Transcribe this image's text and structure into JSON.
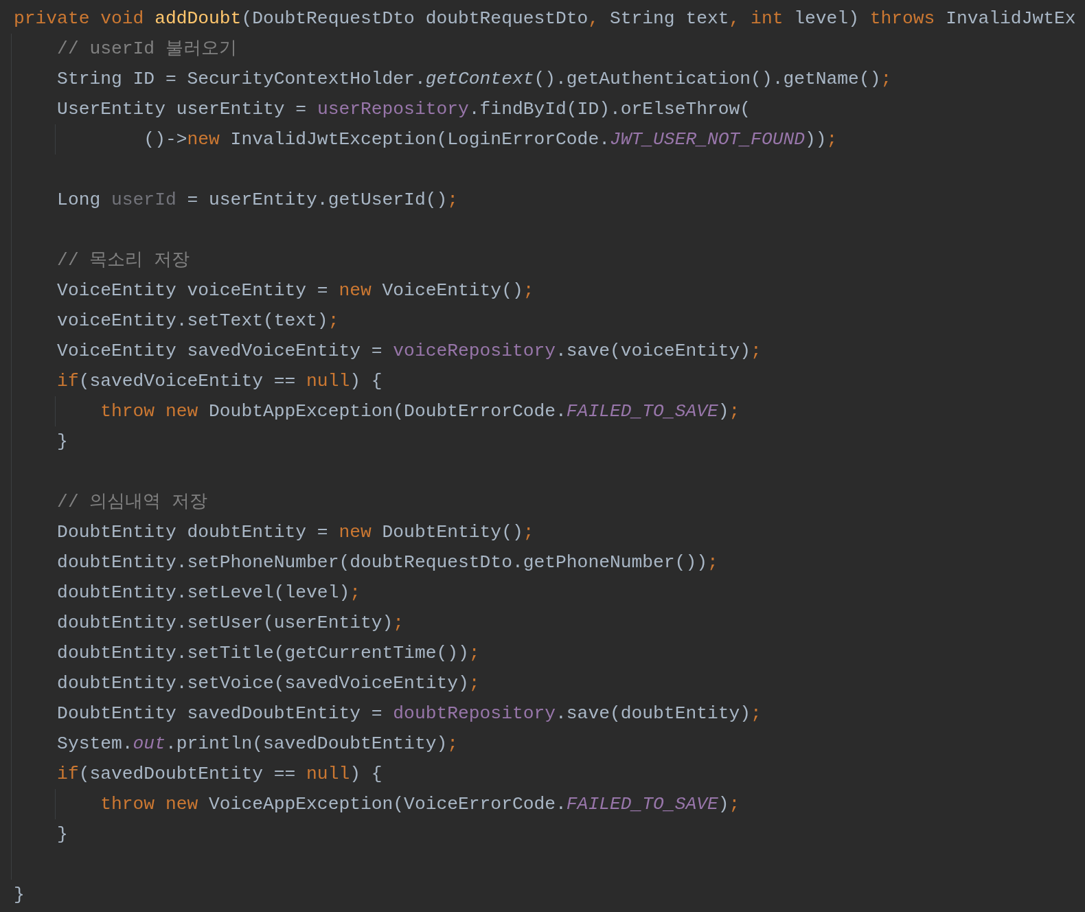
{
  "editor": {
    "lines": [
      {
        "kind": "code",
        "tokens": [
          {
            "kind": "keyword",
            "text": "private void "
          },
          {
            "kind": "method",
            "text": "addDoubt"
          },
          {
            "kind": "plain",
            "text": "(DoubtRequestDto doubtRequestDto"
          },
          {
            "kind": "keyword",
            "text": ", "
          },
          {
            "kind": "plain",
            "text": "String text"
          },
          {
            "kind": "keyword",
            "text": ", int "
          },
          {
            "kind": "plain",
            "text": "level) "
          },
          {
            "kind": "keyword",
            "text": "throws "
          },
          {
            "kind": "plain",
            "text": "InvalidJwtEx"
          }
        ]
      },
      {
        "kind": "code",
        "tokens": [
          {
            "kind": "comment",
            "text": "    // userId 불러오기"
          }
        ]
      },
      {
        "kind": "code",
        "tokens": [
          {
            "kind": "plain",
            "text": "    String ID = SecurityContextHolder."
          },
          {
            "kind": "static_call",
            "text": "getContext"
          },
          {
            "kind": "plain",
            "text": "().getAuthentication().getName()"
          },
          {
            "kind": "keyword",
            "text": ";"
          }
        ]
      },
      {
        "kind": "code",
        "tokens": [
          {
            "kind": "plain",
            "text": "    UserEntity userEntity = "
          },
          {
            "kind": "field",
            "text": "userRepository"
          },
          {
            "kind": "plain",
            "text": ".findById(ID).orElseThrow("
          }
        ]
      },
      {
        "kind": "code",
        "tokens": [
          {
            "kind": "plain",
            "text": "            ()->"
          },
          {
            "kind": "keyword",
            "text": "new"
          },
          {
            "kind": "plain",
            "text": " InvalidJwtException(LoginErrorCode."
          },
          {
            "kind": "static_field",
            "text": "JWT_USER_NOT_FOUND"
          },
          {
            "kind": "plain",
            "text": "))"
          },
          {
            "kind": "keyword",
            "text": ";"
          }
        ]
      },
      {
        "kind": "blank"
      },
      {
        "kind": "code",
        "tokens": [
          {
            "kind": "plain",
            "text": "    Long "
          },
          {
            "kind": "unused",
            "text": "userId"
          },
          {
            "kind": "plain",
            "text": " = userEntity.getUserId()"
          },
          {
            "kind": "keyword",
            "text": ";"
          }
        ]
      },
      {
        "kind": "blank"
      },
      {
        "kind": "code",
        "tokens": [
          {
            "kind": "comment",
            "text": "    // 목소리 저장"
          }
        ]
      },
      {
        "kind": "code",
        "tokens": [
          {
            "kind": "plain",
            "text": "    VoiceEntity voiceEntity = "
          },
          {
            "kind": "keyword",
            "text": "new "
          },
          {
            "kind": "plain",
            "text": "VoiceEntity()"
          },
          {
            "kind": "keyword",
            "text": ";"
          }
        ]
      },
      {
        "kind": "code",
        "tokens": [
          {
            "kind": "plain",
            "text": "    voiceEntity.setText(text)"
          },
          {
            "kind": "keyword",
            "text": ";"
          }
        ]
      },
      {
        "kind": "code",
        "tokens": [
          {
            "kind": "plain",
            "text": "    VoiceEntity savedVoiceEntity = "
          },
          {
            "kind": "field",
            "text": "voiceRepository"
          },
          {
            "kind": "plain",
            "text": ".save(voiceEntity)"
          },
          {
            "kind": "keyword",
            "text": ";"
          }
        ]
      },
      {
        "kind": "code",
        "tokens": [
          {
            "kind": "keyword",
            "text": "    if"
          },
          {
            "kind": "plain",
            "text": "(savedVoiceEntity == "
          },
          {
            "kind": "keyword",
            "text": "null"
          },
          {
            "kind": "plain",
            "text": ") {"
          }
        ]
      },
      {
        "kind": "code",
        "tokens": [
          {
            "kind": "keyword",
            "text": "        throw new "
          },
          {
            "kind": "plain",
            "text": "DoubtAppException(DoubtErrorCode."
          },
          {
            "kind": "static_field",
            "text": "FAILED_TO_SAVE"
          },
          {
            "kind": "plain",
            "text": ")"
          },
          {
            "kind": "keyword",
            "text": ";"
          }
        ]
      },
      {
        "kind": "code",
        "tokens": [
          {
            "kind": "plain",
            "text": "    }"
          }
        ]
      },
      {
        "kind": "blank"
      },
      {
        "kind": "code",
        "tokens": [
          {
            "kind": "comment",
            "text": "    // 의심내역 저장"
          }
        ]
      },
      {
        "kind": "code",
        "tokens": [
          {
            "kind": "plain",
            "text": "    DoubtEntity doubtEntity = "
          },
          {
            "kind": "keyword",
            "text": "new "
          },
          {
            "kind": "plain",
            "text": "DoubtEntity()"
          },
          {
            "kind": "keyword",
            "text": ";"
          }
        ]
      },
      {
        "kind": "code",
        "tokens": [
          {
            "kind": "plain",
            "text": "    doubtEntity.setPhoneNumber(doubtRequestDto.getPhoneNumber())"
          },
          {
            "kind": "keyword",
            "text": ";"
          }
        ]
      },
      {
        "kind": "code",
        "tokens": [
          {
            "kind": "plain",
            "text": "    doubtEntity.setLevel(level)"
          },
          {
            "kind": "keyword",
            "text": ";"
          }
        ]
      },
      {
        "kind": "code",
        "tokens": [
          {
            "kind": "plain",
            "text": "    doubtEntity.setUser(userEntity)"
          },
          {
            "kind": "keyword",
            "text": ";"
          }
        ]
      },
      {
        "kind": "code",
        "tokens": [
          {
            "kind": "plain",
            "text": "    doubtEntity.setTitle(getCurrentTime())"
          },
          {
            "kind": "keyword",
            "text": ";"
          }
        ]
      },
      {
        "kind": "code",
        "tokens": [
          {
            "kind": "plain",
            "text": "    doubtEntity.setVoice(savedVoiceEntity)"
          },
          {
            "kind": "keyword",
            "text": ";"
          }
        ]
      },
      {
        "kind": "code",
        "tokens": [
          {
            "kind": "plain",
            "text": "    DoubtEntity savedDoubtEntity = "
          },
          {
            "kind": "field",
            "text": "doubtRepository"
          },
          {
            "kind": "plain",
            "text": ".save(doubtEntity)"
          },
          {
            "kind": "keyword",
            "text": ";"
          }
        ]
      },
      {
        "kind": "code",
        "tokens": [
          {
            "kind": "plain",
            "text": "    System."
          },
          {
            "kind": "static_field",
            "text": "out"
          },
          {
            "kind": "plain",
            "text": ".println(savedDoubtEntity)"
          },
          {
            "kind": "keyword",
            "text": ";"
          }
        ]
      },
      {
        "kind": "code",
        "tokens": [
          {
            "kind": "keyword",
            "text": "    if"
          },
          {
            "kind": "plain",
            "text": "(savedDoubtEntity == "
          },
          {
            "kind": "keyword",
            "text": "null"
          },
          {
            "kind": "plain",
            "text": ") {"
          }
        ]
      },
      {
        "kind": "code",
        "tokens": [
          {
            "kind": "keyword",
            "text": "        throw new "
          },
          {
            "kind": "plain",
            "text": "VoiceAppException(VoiceErrorCode."
          },
          {
            "kind": "static_field",
            "text": "FAILED_TO_SAVE"
          },
          {
            "kind": "plain",
            "text": ")"
          },
          {
            "kind": "keyword",
            "text": ";"
          }
        ]
      },
      {
        "kind": "code",
        "tokens": [
          {
            "kind": "plain",
            "text": "    }"
          }
        ]
      },
      {
        "kind": "blank"
      },
      {
        "kind": "code",
        "tokens": [
          {
            "kind": "plain",
            "text": "}"
          }
        ]
      }
    ]
  }
}
